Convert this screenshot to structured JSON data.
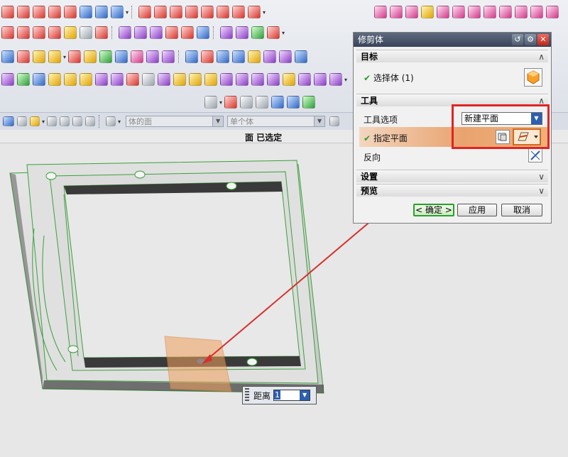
{
  "status_bar": {
    "text": "面 已选定"
  },
  "filter_bar": {
    "type_filter": "体的面",
    "scope_filter": "单个体"
  },
  "distance_popup": {
    "label": "距离",
    "value": "1"
  },
  "dialog": {
    "title": "修剪体",
    "title_buttons": [
      "reset-icon",
      "settings-icon",
      "close-icon"
    ],
    "target_section": {
      "header": "目标",
      "select_body_label": "选择体 (1)"
    },
    "tool_section": {
      "header": "工具",
      "tool_option_label": "工具选项",
      "tool_option_value": "新建平面",
      "specify_plane_label": "指定平面",
      "reverse_label": "反向"
    },
    "settings_section": {
      "header": "设置"
    },
    "preview_section": {
      "header": "预览"
    },
    "buttons": {
      "ok": "< 确定 >",
      "apply": "应用",
      "cancel": "取消"
    }
  },
  "colors": {
    "highlight_frame": "#e02424",
    "model_edge": "#3aa03a",
    "plane_fill": "#f0a15c",
    "arrow": "#d6302c",
    "check": "#2c9a2c"
  }
}
